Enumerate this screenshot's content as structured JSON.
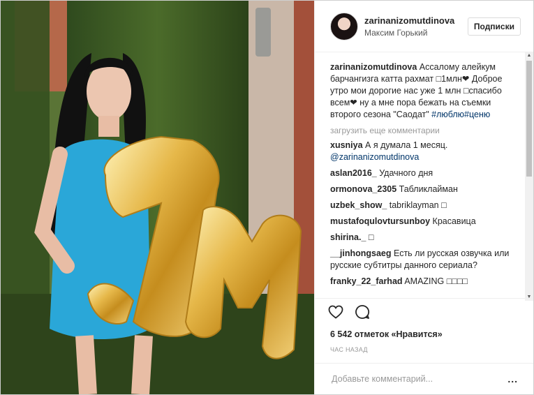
{
  "post": {
    "username": "zarinanizomutdinova",
    "location": "Максим Горький",
    "follow_label": "Подписки",
    "caption_user": "zarinanizomutdinova",
    "caption_text": " Ассалому алейкум барчангизга катта рахмат □1млн❤ Доброе утро мои дорогие нас уже 1 млн □спасибо всем❤ ну а мне пора бежать на съемки второго сезона \"Саодат\" ",
    "caption_tags": "#люблю#ценю",
    "load_more": "загрузить еще комментарии",
    "comments": [
      {
        "user": "xusniya",
        "text": " А я думала 1 месяц. ",
        "mention": "@zarinanizomutdinova"
      },
      {
        "user": "aslan2016_",
        "text": " Удачного дня"
      },
      {
        "user": "ormonova_2305",
        "text": " Табликлайман"
      },
      {
        "user": "uzbek_show_",
        "text": " tabriklayman □"
      },
      {
        "user": "mustafoqulovtursunboy",
        "text": " Красавица"
      },
      {
        "user": "shirina._",
        "text": " □"
      },
      {
        "user": "__jinhongsaeg",
        "text": " Есть ли русская озвучка или русские субтитры данного сериала?"
      },
      {
        "user": "franky_22_farhad",
        "text": " AMAZING □□□□"
      }
    ],
    "likes": "6 542 отметок «Нравится»",
    "time": "час назад",
    "add_placeholder": "Добавьте комментарий...",
    "more_label": "..."
  },
  "icons": {
    "like": "heart-icon",
    "comment": "comment-icon"
  },
  "colors": {
    "link": "#003569",
    "text": "#262626",
    "muted": "#999999"
  }
}
